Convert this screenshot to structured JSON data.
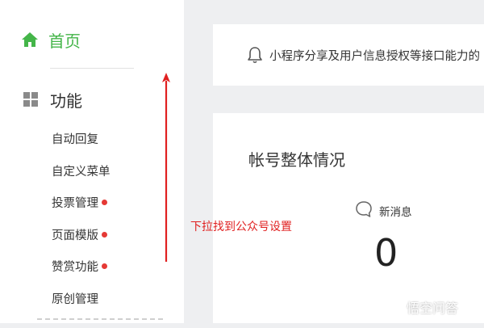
{
  "sidebar": {
    "home_label": "首页",
    "function_label": "功能",
    "items": [
      {
        "label": "自动回复",
        "dot": false
      },
      {
        "label": "自定义菜单",
        "dot": false
      },
      {
        "label": "投票管理",
        "dot": true
      },
      {
        "label": "页面模版",
        "dot": true
      },
      {
        "label": "赞赏功能",
        "dot": true
      },
      {
        "label": "原创管理",
        "dot": false
      }
    ]
  },
  "notice": {
    "text": "小程序分享及用户信息授权等接口能力的"
  },
  "stats": {
    "title": "帐号整体情况",
    "new_message_label": "新消息",
    "new_message_count": "0"
  },
  "annotation": {
    "text": "下拉找到公众号设置"
  },
  "watermark": {
    "text": "悟空问答"
  },
  "colors": {
    "accent_green": "#44b549",
    "badge_red": "#e53935",
    "annotation_red": "#e02020"
  }
}
